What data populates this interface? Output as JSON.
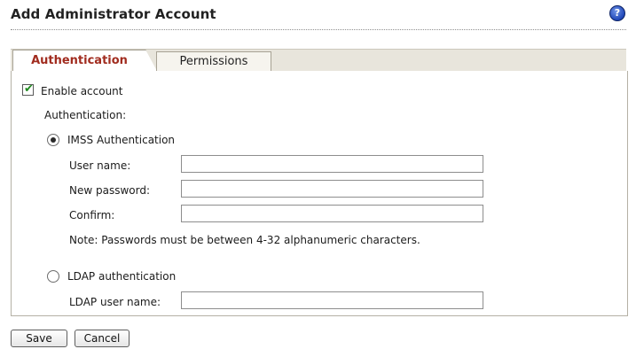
{
  "page": {
    "title": "Add Administrator Account",
    "help_icon": "question-circle-icon",
    "help_glyph": "?"
  },
  "tabs": [
    {
      "label": "Authentication",
      "active": true
    },
    {
      "label": "Permissions",
      "active": false
    }
  ],
  "form": {
    "enable_account": {
      "label": "Enable account",
      "checked": true
    },
    "auth_heading": "Authentication:",
    "imss": {
      "label": "IMSS Authentication",
      "selected": true,
      "user_name_label": "User name:",
      "user_name_value": "",
      "new_password_label": "New password:",
      "new_password_value": "",
      "confirm_label": "Confirm:",
      "confirm_value": "",
      "note": "Note: Passwords must be between 4-32 alphanumeric characters."
    },
    "ldap": {
      "label": "LDAP authentication",
      "selected": false,
      "user_name_label": "LDAP user name:",
      "user_name_value": ""
    }
  },
  "actions": {
    "save_label": "Save",
    "cancel_label": "Cancel"
  },
  "colors": {
    "active_tab_text": "#a12c1f",
    "tab_bar": "#e8e5dc",
    "check_mark": "#1f8a1f",
    "help_icon": "#1f47b8"
  }
}
